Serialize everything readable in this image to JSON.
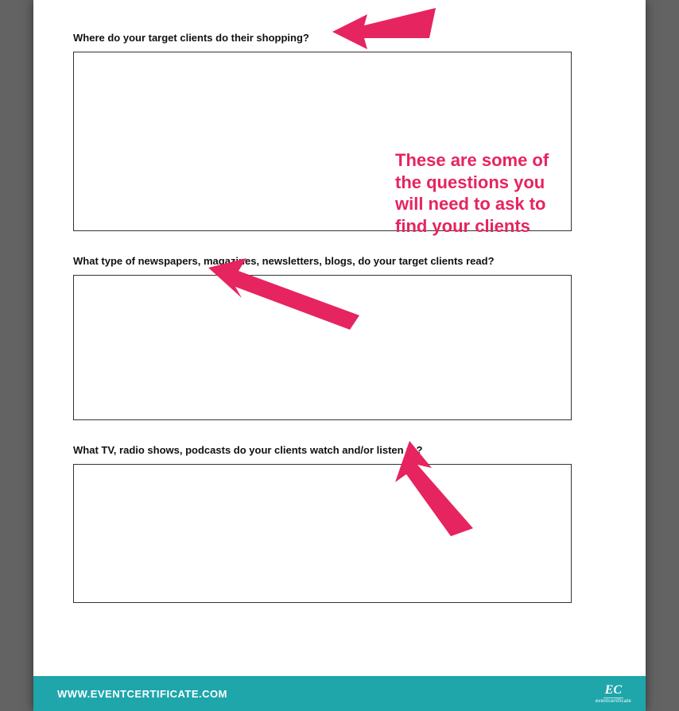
{
  "questions": [
    {
      "label": "Where do your target clients do their shopping?",
      "box_height": "box-h-226"
    },
    {
      "label": "What type of newspapers, magazines, newsletters, blogs, do your target clients read?",
      "box_height": "box-h-183"
    },
    {
      "label": "What TV, radio shows, podcasts do your clients watch and/or listen to?",
      "box_height": "box-h-175"
    }
  ],
  "footer": {
    "url": "WWW.EVENTCERTIFICATE.COM",
    "logo_main": "EC",
    "logo_sub": "eventcertificate"
  },
  "annotation": {
    "callout": "These are some of\nthe questions you\nwill need to ask to\nfind your clients",
    "color": "#e6245f"
  }
}
